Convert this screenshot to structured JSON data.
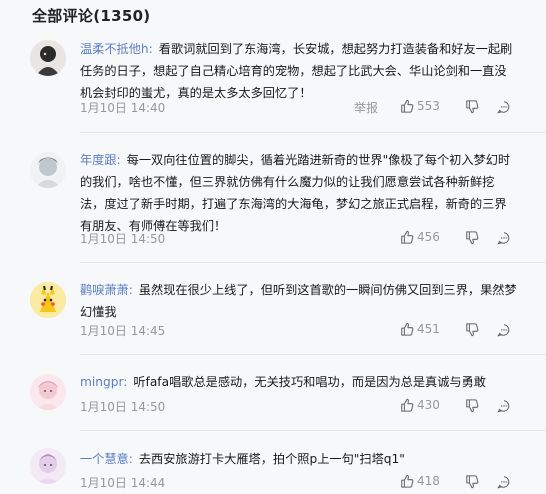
{
  "section_title": "全部评论(1350)",
  "comments": [
    {
      "user": "温柔不抵他h:",
      "text": "看歌词就回到了东海湾，长安城，想起努力打造装备和好友一起刷任务的日子，想起了自己精心培育的宠物，想起了比武大会、华山论剑和一直没机会封印的蚩尤，真的是太多太多回忆了！",
      "time": "1月10日 14:40",
      "report": "举报",
      "likes": "553",
      "avatar_color": "#3a3a3a"
    },
    {
      "user": "年度跟:",
      "text": "每一双向往位置的脚尖，循着光踏进新奇的世界\"像极了每个初入梦幻时的我们，啥也不懂，但三界就仿佛有什么魔力似的让我们愿意尝试各种新鲜挖法，度过了新手时期，打遍了东海湾的大海龟，梦幻之旅正式启程，新奇的三界有朋友、有师傅在等我们！",
      "time": "1月10日 14:50",
      "report": "",
      "likes": "456",
      "avatar_color": "#c8cfd6"
    },
    {
      "user": "鹳唳萧萧:",
      "text": "虽然现在很少上线了，但听到这首歌的一瞬间仿佛又回到三界，果然梦幻懂我",
      "time": "1月10日 14:45",
      "report": "",
      "likes": "451",
      "avatar_color": "#f5d53a"
    },
    {
      "user": "mingpr:",
      "text": "听fafa唱歌总是感动，无关技巧和唱功，而是因为总是真诚与勇敢",
      "time": "1月10日 14:50",
      "report": "",
      "likes": "430",
      "avatar_color": "#f1d6dc"
    },
    {
      "user": "一个慧意:",
      "text": "去西安旅游打卡大雁塔，拍个照p上一句\"扫塔q1\"",
      "time": "1月10日 14:44",
      "report": "",
      "likes": "418",
      "avatar_color": "#e7d6ea"
    }
  ]
}
